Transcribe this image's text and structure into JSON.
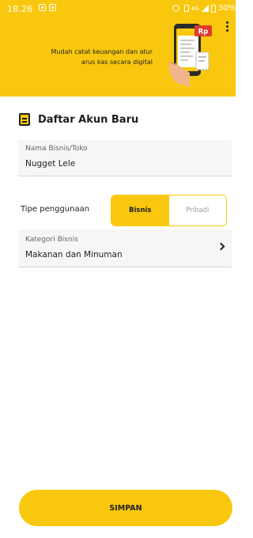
{
  "status_bar": {
    "time": "18.26",
    "network": "4G",
    "battery": "30%"
  },
  "header": {
    "tagline_line1": "Mudah catat keuangan dan atur",
    "tagline_line2": "arus kas secara digital",
    "badge": "Rp"
  },
  "page": {
    "title": "Daftar Akun Baru"
  },
  "form": {
    "business_name": {
      "label": "Nama Bisnis/Toko",
      "value": "Nugget Lele"
    },
    "usage_type": {
      "label": "Tipe penggunaan",
      "options": [
        "Bisnis",
        "Pribadi"
      ],
      "selected": "Bisnis"
    },
    "category": {
      "label": "Kategori Bisnis",
      "value": "Makanan dan Minuman"
    }
  },
  "actions": {
    "save_label": "SIMPAN"
  },
  "colors": {
    "brand_yellow": "#f9c80e",
    "text_dark": "#1f1f1f",
    "inactive_text": "#9a9a9a"
  },
  "icons": [
    "gallery-icon",
    "alarm-icon",
    "vibrate-icon",
    "signal-icon",
    "battery-icon",
    "more-vert-icon",
    "document-icon",
    "chevron-right-icon"
  ]
}
